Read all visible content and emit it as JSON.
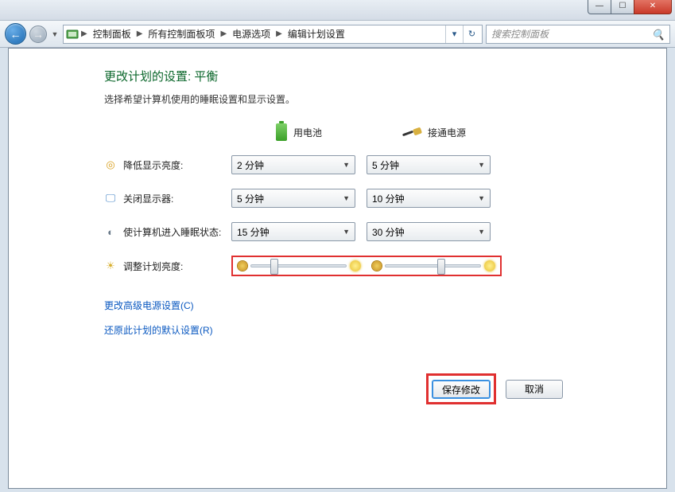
{
  "titlebar": {
    "min_tooltip": "最小化",
    "max_tooltip": "最大化",
    "close_tooltip": "关闭"
  },
  "breadcrumb": {
    "root": "控制面板",
    "all": "所有控制面板项",
    "power": "电源选项",
    "edit": "编辑计划设置"
  },
  "search": {
    "placeholder": "搜索控制面板"
  },
  "page": {
    "title": "更改计划的设置: 平衡",
    "subtitle": "选择希望计算机使用的睡眠设置和显示设置。"
  },
  "columns": {
    "battery": "用电池",
    "plugged": "接通电源"
  },
  "rows": {
    "dim": {
      "label": "降低显示亮度:",
      "battery": "2 分钟",
      "plugged": "5 分钟"
    },
    "off": {
      "label": "关闭显示器:",
      "battery": "5 分钟",
      "plugged": "10 分钟"
    },
    "sleep": {
      "label": "使计算机进入睡眠状态:",
      "battery": "15 分钟",
      "plugged": "30 分钟"
    },
    "brightness": {
      "label": "调整计划亮度:",
      "battery_pct": 20,
      "plugged_pct": 55
    }
  },
  "links": {
    "advanced": "更改高级电源设置(C)",
    "restore": "还原此计划的默认设置(R)"
  },
  "buttons": {
    "save": "保存修改",
    "cancel": "取消"
  }
}
